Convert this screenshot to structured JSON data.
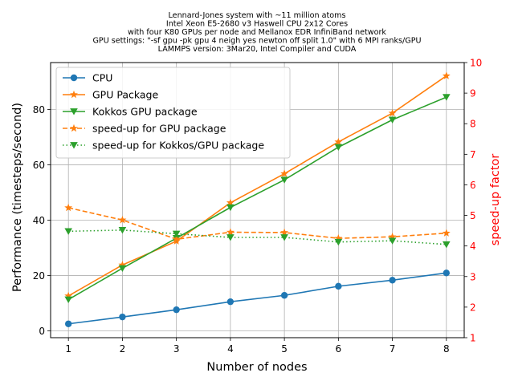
{
  "chart_data": {
    "type": "line",
    "title_lines": [
      "Lennard-Jones system with ~11 million atoms",
      "Intel Xeon E5-2680 v3 Haswell CPU 2x12 Cores",
      "with four K80 GPUs per node and Mellanox EDR InfiniBand network",
      "GPU settings: \"-sf gpu -pk gpu 4 neigh yes newton off split 1.0\" with 6 MPI ranks/GPU",
      "LAMMPS version: 3Mar20, Intel Compiler and CUDA"
    ],
    "xlabel": "Number of nodes",
    "ylabel": "Performance (timesteps/second)",
    "y2label": "speed-up factor",
    "y2label_color": "#ff0000",
    "x": [
      1,
      2,
      3,
      4,
      5,
      6,
      7,
      8
    ],
    "xticks": [
      "1",
      "2",
      "3",
      "4",
      "5",
      "6",
      "7",
      "8"
    ],
    "xlim": [
      0.67,
      8.33
    ],
    "ylim": [
      -2.5,
      97.0
    ],
    "yticks": [
      "0",
      "20",
      "40",
      "60",
      "80"
    ],
    "y2lim": [
      1,
      10
    ],
    "y2ticks": [
      "1",
      "2",
      "3",
      "4",
      "5",
      "6",
      "7",
      "8",
      "9",
      "10"
    ],
    "grid": true,
    "legend_position": "top-left",
    "series": [
      {
        "name": "CPU",
        "axis": "left",
        "color": "#1f77b4",
        "marker": "circle",
        "dash": "solid",
        "values": [
          2.5,
          5.0,
          7.6,
          10.5,
          12.8,
          16.1,
          18.3,
          20.9
        ]
      },
      {
        "name": "GPU Package",
        "axis": "left",
        "color": "#ff7f0e",
        "marker": "star",
        "dash": "solid",
        "values": [
          12.6,
          23.8,
          32.4,
          46.3,
          56.8,
          68.3,
          78.7,
          92.2
        ]
      },
      {
        "name": "Kokkos GPU package",
        "axis": "left",
        "color": "#2ca02c",
        "marker": "triangle-down",
        "dash": "solid",
        "values": [
          11.3,
          22.6,
          33.5,
          44.6,
          54.6,
          66.4,
          76.3,
          84.5
        ]
      },
      {
        "name": "speed-up for GPU package",
        "axis": "right",
        "color": "#ff7f0e",
        "marker": "star",
        "dash": "dashed",
        "values": [
          5.25,
          4.85,
          4.22,
          4.45,
          4.44,
          4.25,
          4.3,
          4.42
        ]
      },
      {
        "name": "speed-up for Kokkos/GPU package",
        "axis": "right",
        "color": "#2ca02c",
        "marker": "triangle-down",
        "dash": "dotted",
        "values": [
          4.48,
          4.52,
          4.4,
          4.28,
          4.28,
          4.13,
          4.17,
          4.05
        ]
      }
    ]
  }
}
